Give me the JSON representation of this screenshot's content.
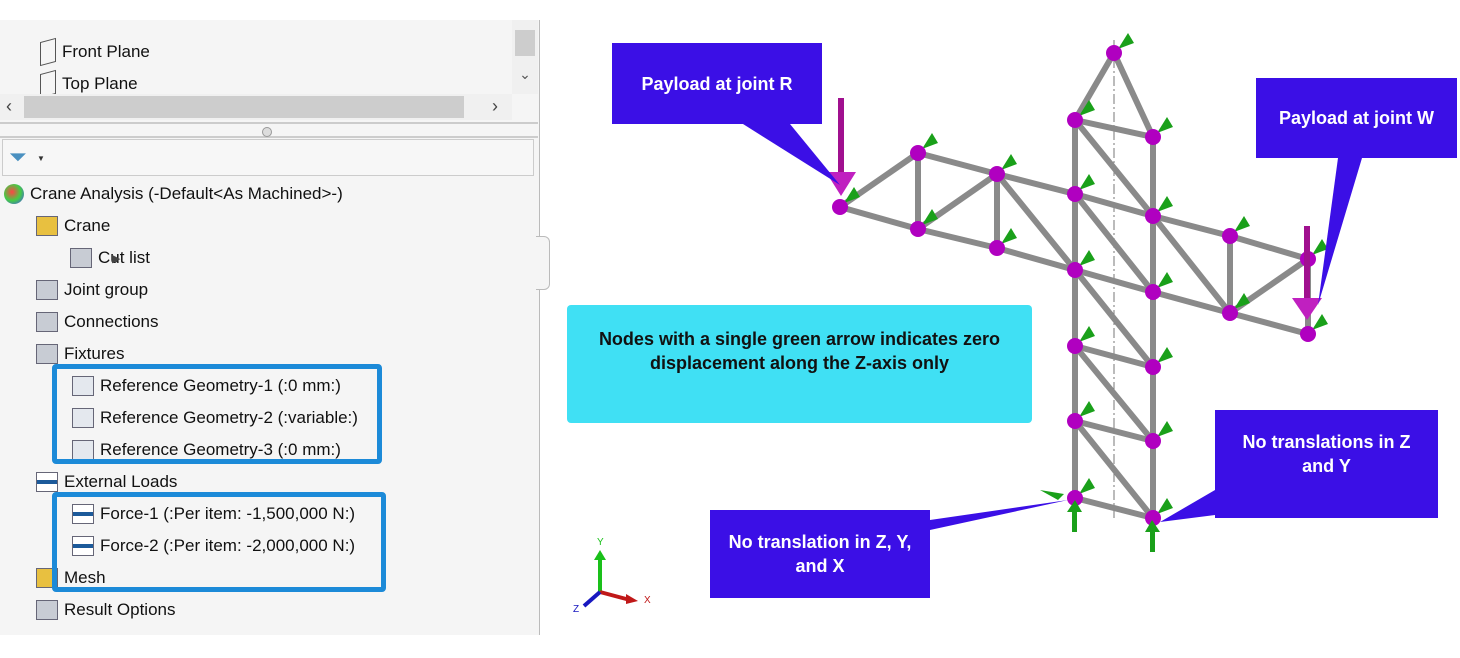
{
  "tree_top": {
    "items": [
      {
        "label": "Front Plane",
        "icon": "plane-icon"
      },
      {
        "label": "Top Plane",
        "icon": "plane-icon"
      }
    ]
  },
  "study_tree": {
    "root": "Crane Analysis (-Default<As Machined>-)",
    "items": [
      {
        "label": "Crane",
        "icon": "part-icon"
      },
      {
        "label": "Cut list",
        "icon": "cut-list-icon"
      },
      {
        "label": "Joint group",
        "icon": "joint-group-icon"
      },
      {
        "label": "Connections",
        "icon": "connections-icon"
      },
      {
        "label": "Fixtures",
        "icon": "fixtures-icon"
      },
      {
        "label": "Reference Geometry-1 (:0 mm:)",
        "icon": "reference-geometry-icon"
      },
      {
        "label": "Reference Geometry-2 (:variable:)",
        "icon": "reference-geometry-icon"
      },
      {
        "label": "Reference Geometry-3 (:0 mm:)",
        "icon": "reference-geometry-icon"
      },
      {
        "label": "External Loads",
        "icon": "external-loads-icon"
      },
      {
        "label": "Force-1 (:Per item: -1,500,000 N:)",
        "icon": "force-icon"
      },
      {
        "label": "Force-2 (:Per item: -2,000,000 N:)",
        "icon": "force-icon"
      },
      {
        "label": "Mesh",
        "icon": "mesh-icon"
      },
      {
        "label": "Result Options",
        "icon": "result-options-icon"
      }
    ]
  },
  "callouts": {
    "payload_r": "Payload at joint R",
    "payload_w": "Payload at joint W",
    "note": "Nodes with a single green arrow indicates zero displacement along the Z-axis only",
    "zyx": "No translation in Z, Y, and X",
    "zy": "No translations in Z and Y"
  },
  "triad": {
    "x": "X",
    "y": "Y",
    "z": "Z"
  },
  "colors": {
    "callout": "#3b0fe6",
    "note": "#40e0f4",
    "node": "#b000c0",
    "fixture": "#1aa01a",
    "highlight": "#1c8ad8"
  }
}
